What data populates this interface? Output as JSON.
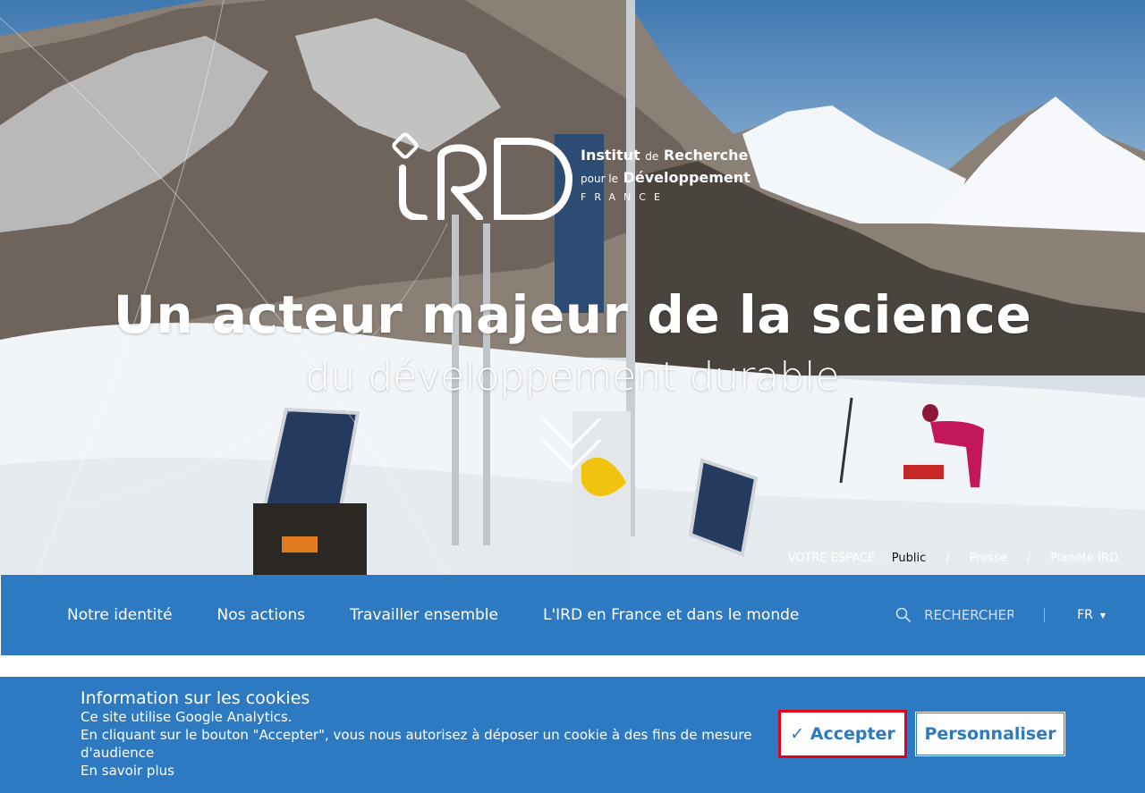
{
  "logo": {
    "line1_a": "Institut",
    "line1_b": "de",
    "line1_c": "Recherche",
    "line2_a": "pour le",
    "line2_b": "Développement",
    "country": "FRANCE"
  },
  "hero": {
    "title": "Un acteur majeur de la science",
    "subtitle": "du développement durable"
  },
  "espace": {
    "label": "VOTRE ESPACE :",
    "items": [
      "Public",
      "Presse",
      "Planète IRD"
    ],
    "separator": "/"
  },
  "nav": {
    "items": [
      "Notre identité",
      "Nos actions",
      "Travailler ensemble",
      "L'IRD en France et dans le monde"
    ],
    "search_placeholder": "RECHERCHER",
    "lang": "FR"
  },
  "cookie": {
    "title": "Information sur les cookies",
    "line1": "Ce site utilise Google Analytics.",
    "line2": "En cliquant sur le bouton \"Accepter\", vous nous autorisez à déposer un cookie à des fins de mesure d'audience",
    "link": "En savoir plus",
    "accept_label": "✓ Accepter",
    "customize_label": "Personnaliser"
  },
  "colors": {
    "brand_blue": "#2e7ac2",
    "focus_red": "#e3001b"
  }
}
